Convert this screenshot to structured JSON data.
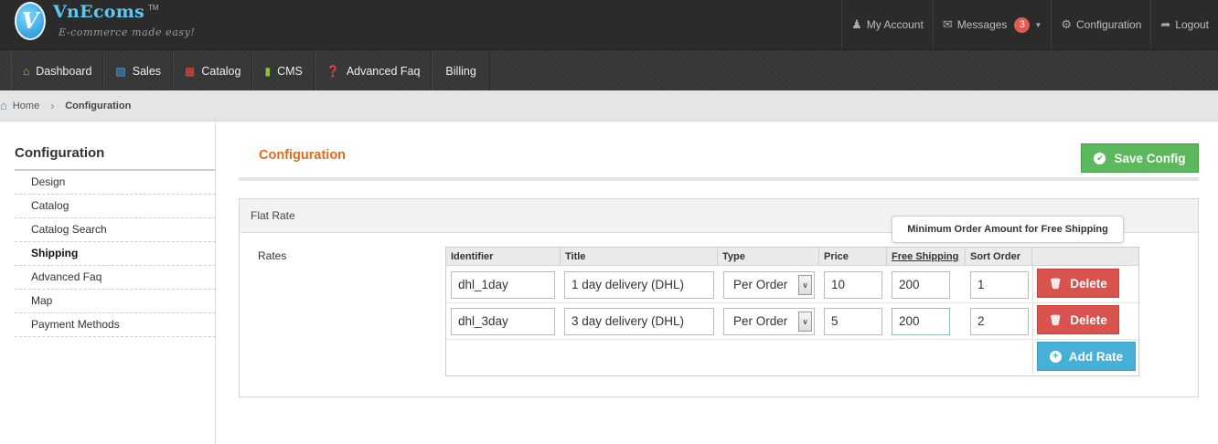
{
  "brand": {
    "logo_letter": "V",
    "name": "VnEcoms",
    "tm": "TM",
    "tagline": "E-commerce made easy!"
  },
  "top_nav": {
    "my_account": "My Account",
    "messages": "Messages",
    "messages_count": "3",
    "configuration": "Configuration",
    "logout": "Logout"
  },
  "menu": {
    "items": [
      {
        "label": "Dashboard",
        "icon": "home-icon"
      },
      {
        "label": "Sales",
        "icon": "bar-chart-icon"
      },
      {
        "label": "Catalog",
        "icon": "gift-icon"
      },
      {
        "label": "CMS",
        "icon": "book-icon"
      },
      {
        "label": "Advanced Faq",
        "icon": "question-icon"
      },
      {
        "label": "Billing",
        "icon": ""
      }
    ]
  },
  "breadcrumb": {
    "home": "Home",
    "current": "Configuration"
  },
  "sidebar": {
    "title": "Configuration",
    "items": [
      {
        "label": "Design"
      },
      {
        "label": "Catalog"
      },
      {
        "label": "Catalog Search"
      },
      {
        "label": "Shipping",
        "active": true
      },
      {
        "label": "Advanced Faq"
      },
      {
        "label": "Map"
      },
      {
        "label": "Payment Methods"
      }
    ]
  },
  "content": {
    "title": "Configuration",
    "save_label": "Save Config",
    "panel_title": "Flat Rate",
    "rates_label": "Rates",
    "tooltip": "Minimum Order Amount for Free Shipping"
  },
  "grid": {
    "headers": {
      "identifier": "Identifier",
      "title": "Title",
      "type": "Type",
      "price": "Price",
      "free_shipping": "Free Shipping",
      "sort_order": "Sort Order"
    },
    "rows": [
      {
        "identifier": "dhl_1day",
        "title": "1 day delivery (DHL)",
        "type": "Per Order",
        "price": "10",
        "free_shipping": "200",
        "sort_order": "1",
        "delete_label": "Delete"
      },
      {
        "identifier": "dhl_3day",
        "title": "3 day delivery (DHL)",
        "type": "Per Order",
        "price": "5",
        "free_shipping": "200",
        "sort_order": "2",
        "delete_label": "Delete"
      }
    ],
    "add_label": "Add Rate"
  },
  "colors": {
    "accent_orange": "#e06b1b",
    "save_green": "#5cb85c",
    "delete_red": "#d9534f",
    "add_blue": "#46b0d6",
    "badge_red": "#e15b4f"
  }
}
